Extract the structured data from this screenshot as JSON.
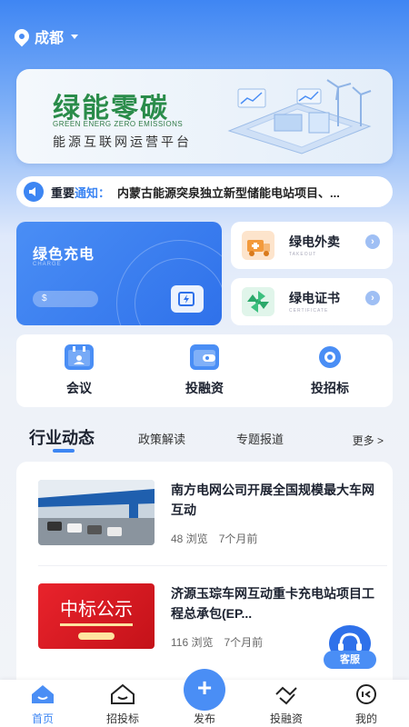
{
  "location": {
    "city": "成都"
  },
  "banner": {
    "title": "绿能零碳",
    "subtitle": "GREEN ENERG ZERO EMISSIONS",
    "tagline": "能源互联网运营平台"
  },
  "notice": {
    "prefix": "重要",
    "keyword": "通知：",
    "text": "内蒙古能源突泉独立新型储能电站项目、..."
  },
  "charge_card": {
    "title": "绿色充电",
    "subtitle": "CHARGE",
    "pill_icon": "$"
  },
  "side_cards": [
    {
      "title": "绿电外卖",
      "subtitle": "TAKEOUT",
      "icon": "delivery-icon"
    },
    {
      "title": "绿电证书",
      "subtitle": "CERTIFICATE",
      "icon": "pinwheel-icon"
    }
  ],
  "quick_menu": [
    {
      "label": "会议",
      "icon": "calendar-icon"
    },
    {
      "label": "投融资",
      "icon": "wallet-icon"
    },
    {
      "label": "投招标",
      "icon": "bid-icon"
    }
  ],
  "section_tabs": {
    "main": "行业动态",
    "tab2": "政策解读",
    "tab3": "专题报道",
    "more": "更多 >"
  },
  "news": [
    {
      "title": "南方电网公司开展全国规模最大车网互动",
      "views": "48 浏览",
      "time": "7个月前"
    },
    {
      "title": "济源玉琮车网互动重卡充电站项目工程总承包(EP...",
      "views": "116 浏览",
      "time": "7个月前"
    }
  ],
  "news_thumb2": {
    "text": "中标公示"
  },
  "service": {
    "label": "客服"
  },
  "bottom_nav": [
    {
      "label": "首页",
      "icon": "home-icon"
    },
    {
      "label": "招投标",
      "icon": "bid-nav-icon"
    },
    {
      "label": "发布",
      "icon": "plus-icon"
    },
    {
      "label": "投融资",
      "icon": "handshake-icon"
    },
    {
      "label": "我的",
      "icon": "profile-icon"
    }
  ],
  "colors": {
    "accent": "#3d86f3",
    "green": "#2a8c4a",
    "orange": "#f39a3c"
  }
}
